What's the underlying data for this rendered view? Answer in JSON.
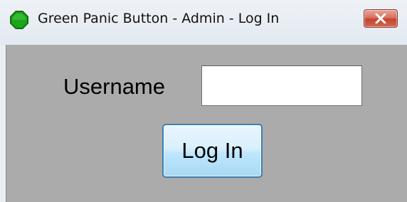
{
  "window": {
    "title": "Green Panic Button - Admin - Log In",
    "icon": "green-octagon-icon",
    "close_icon": "close-x-icon",
    "colors": {
      "client_background": "#ababab",
      "app_icon_green": "#1aa51a",
      "close_button_red": "#c4432e",
      "login_button_border": "#3c7fb1"
    }
  },
  "form": {
    "username_label": "Username",
    "username_value": "",
    "login_button_label": "Log In"
  }
}
